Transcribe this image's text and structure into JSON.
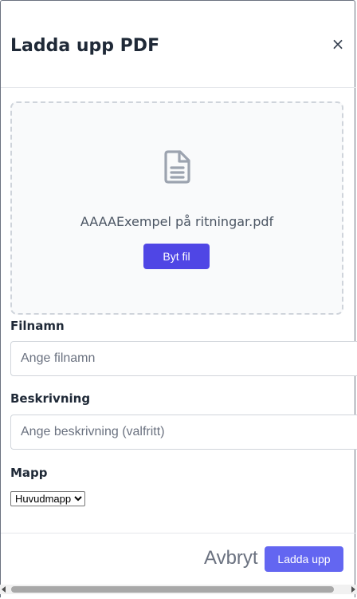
{
  "modal": {
    "title": "Ladda upp PDF",
    "close_icon": "close-icon",
    "close_glyph": "×"
  },
  "upload": {
    "icon": "document-icon",
    "file_name": "AAAAExempel på ritningar.pdf",
    "change_label": "Byt fil"
  },
  "form": {
    "filename_label": "Filnamn",
    "filename_placeholder": "Ange filnamn",
    "filename_value": "",
    "description_label": "Beskrivning",
    "description_placeholder": "Ange beskrivning (valfritt)",
    "description_value": "",
    "folder_label": "Mapp",
    "folder_selected": "Huvudmapp"
  },
  "footer": {
    "cancel_label": "Avbryt",
    "submit_label": "Ladda upp"
  },
  "colors": {
    "primary": "#4f46e5",
    "primary_light": "#6366f1",
    "dropzone_bg": "#f9fafb",
    "dropzone_border": "#cfd4db"
  }
}
